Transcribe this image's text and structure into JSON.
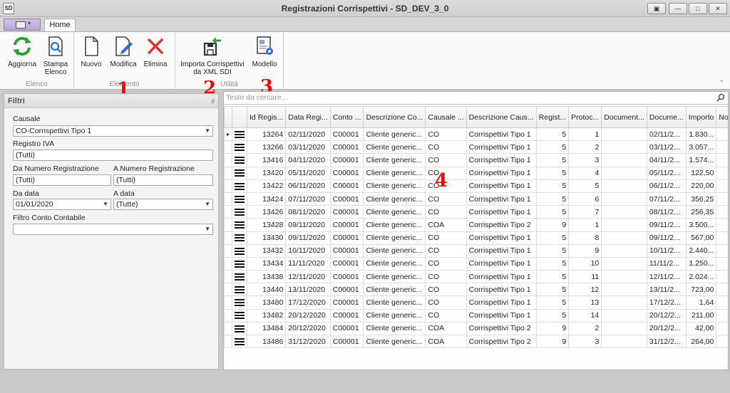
{
  "window": {
    "logo": "SD",
    "title": "Registrazioni Corrispettivi - SD_DEV_3_0",
    "buttons": [
      "restore-icon",
      "minimize-icon",
      "maximize-icon",
      "close-icon"
    ]
  },
  "ribbon": {
    "tabs": [
      {
        "label": "Home",
        "active": true
      }
    ],
    "groups": [
      {
        "label": "Elenco",
        "buttons": [
          {
            "label": "Aggiorna",
            "icon": "refresh-icon"
          },
          {
            "label": "Stampa Elenco",
            "icon": "print-preview-icon"
          }
        ]
      },
      {
        "label": "Elemento",
        "buttons": [
          {
            "label": "Nuovo",
            "icon": "new-document-icon"
          },
          {
            "label": "Modifica",
            "icon": "edit-icon"
          },
          {
            "label": "Elimina",
            "icon": "delete-icon"
          }
        ]
      },
      {
        "label": "Utilità",
        "buttons": [
          {
            "label": "Importa Corrispettivi da XML SDI",
            "icon": "import-icon"
          },
          {
            "label": "Modello",
            "icon": "template-settings-icon"
          }
        ]
      }
    ]
  },
  "callouts": [
    "1",
    "2",
    "3",
    "4"
  ],
  "filters": {
    "title": "Filtri",
    "causale_label": "Causale",
    "causale_value": "CO-Corrispettivi Tipo 1",
    "registro_label": "Registro IVA",
    "registro_value": "(Tutti)",
    "da_num_label": "Da Numero Registrazione",
    "da_num_value": "(Tutti)",
    "a_num_label": "A Numero Registrazione",
    "a_num_value": "(Tutti)",
    "da_data_label": "Da data",
    "da_data_value": "01/01/2020",
    "a_data_label": "A data",
    "a_data_value": "(Tutte)",
    "conto_label": "Filtro Conto Contabile",
    "conto_value": ""
  },
  "grid": {
    "search_placeholder": "Testo da cercare...",
    "columns": [
      "",
      "",
      "Id Regis...",
      "Data Regi...",
      "Conto ...",
      "Descrizione Co...",
      "Causale ...",
      "Descrizione Caus...",
      "Regist...",
      "Protoc...",
      "Document...",
      "Docume...",
      "Importo",
      "Nota Regis..."
    ],
    "rows": [
      [
        "13264",
        "02/11/2020",
        "C00001",
        "Cliente generic...",
        "CO",
        "Corrispettivi Tipo 1",
        "5",
        "1",
        "",
        "02/11/2...",
        "1.830...",
        ""
      ],
      [
        "13266",
        "03/11/2020",
        "C00001",
        "Cliente generic...",
        "CO",
        "Corrispettivi Tipo 1",
        "5",
        "2",
        "",
        "03/11/2...",
        "3.057...",
        ""
      ],
      [
        "13416",
        "04/11/2020",
        "C00001",
        "Cliente generic...",
        "CO",
        "Corrispettivi Tipo 1",
        "5",
        "3",
        "",
        "04/11/2...",
        "1.574...",
        ""
      ],
      [
        "13420",
        "05/11/2020",
        "C00001",
        "Cliente generic...",
        "CO",
        "Corrispettivi Tipo 1",
        "5",
        "4",
        "",
        "05/11/2...",
        "122,50",
        ""
      ],
      [
        "13422",
        "06/11/2020",
        "C00001",
        "Cliente generic...",
        "CO",
        "Corrispettivi Tipo 1",
        "5",
        "5",
        "",
        "06/11/2...",
        "220,00",
        ""
      ],
      [
        "13424",
        "07/11/2020",
        "C00001",
        "Cliente generic...",
        "CO",
        "Corrispettivi Tipo 1",
        "5",
        "6",
        "",
        "07/11/2...",
        "356,25",
        ""
      ],
      [
        "13426",
        "08/11/2020",
        "C00001",
        "Cliente generic...",
        "CO",
        "Corrispettivi Tipo 1",
        "5",
        "7",
        "",
        "08/11/2...",
        "256,35",
        ""
      ],
      [
        "13428",
        "09/11/2020",
        "C00001",
        "Cliente generic...",
        "COA",
        "Corrispettivi Tipo 2",
        "9",
        "1",
        "",
        "09/11/2...",
        "3.500...",
        ""
      ],
      [
        "13430",
        "09/11/2020",
        "C00001",
        "Cliente generic...",
        "CO",
        "Corrispettivi Tipo 1",
        "5",
        "8",
        "",
        "09/11/2...",
        "567,00",
        ""
      ],
      [
        "13432",
        "10/11/2020",
        "C00001",
        "Cliente generic...",
        "CO",
        "Corrispettivi Tipo 1",
        "5",
        "9",
        "",
        "10/11/2...",
        "2.440...",
        ""
      ],
      [
        "13434",
        "11/11/2020",
        "C00001",
        "Cliente generic...",
        "CO",
        "Corrispettivi Tipo 1",
        "5",
        "10",
        "",
        "11/11/2...",
        "1.250...",
        ""
      ],
      [
        "13438",
        "12/11/2020",
        "C00001",
        "Cliente generic...",
        "CO",
        "Corrispettivi Tipo 1",
        "5",
        "11",
        "",
        "12/11/2...",
        "2.024...",
        ""
      ],
      [
        "13440",
        "13/11/2020",
        "C00001",
        "Cliente generic...",
        "CO",
        "Corrispettivi Tipo 1",
        "5",
        "12",
        "",
        "13/11/2...",
        "723,00",
        ""
      ],
      [
        "13480",
        "17/12/2020",
        "C00001",
        "Cliente generic...",
        "CO",
        "Corrispettivi Tipo 1",
        "5",
        "13",
        "",
        "17/12/2...",
        "1,64",
        ""
      ],
      [
        "13482",
        "20/12/2020",
        "C00001",
        "Cliente generic...",
        "CO",
        "Corrispettivi Tipo 1",
        "5",
        "14",
        "",
        "20/12/2...",
        "211,00",
        ""
      ],
      [
        "13484",
        "20/12/2020",
        "C00001",
        "Cliente generic...",
        "COA",
        "Corrispettivi Tipo 2",
        "9",
        "2",
        "",
        "20/12/2...",
        "42,00",
        ""
      ],
      [
        "13486",
        "31/12/2020",
        "C00001",
        "Cliente generic...",
        "COA",
        "Corrispettivi Tipo 2",
        "9",
        "3",
        "",
        "31/12/2...",
        "264,00",
        ""
      ]
    ]
  },
  "colors": {
    "callout": "#e01010",
    "refresh": "#2e9e3a",
    "delete": "#e03030",
    "edit": "#2f6fc9"
  }
}
